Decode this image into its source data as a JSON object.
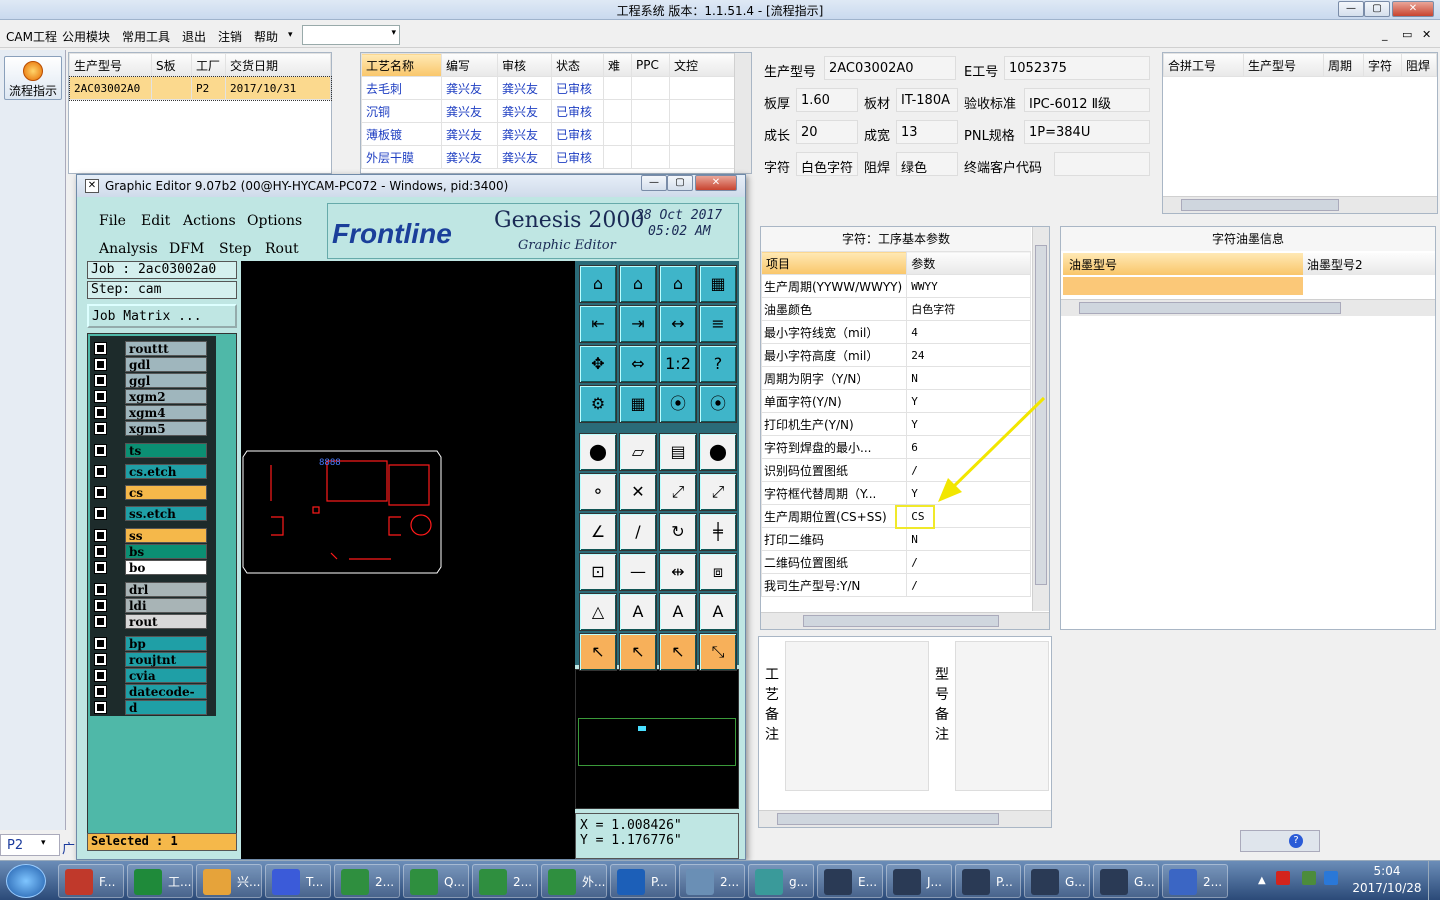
{
  "app": {
    "title": "工程系统  版本：1.1.51.4 - [流程指示]",
    "window_controls": [
      "—",
      "▢",
      "✕"
    ]
  },
  "menubar": {
    "items": [
      "CAM工程",
      "公用模块",
      "常用工具",
      "退出",
      "注销",
      "帮助"
    ],
    "help_arrow": "▾",
    "combo_value": "",
    "mdi_controls": [
      "_",
      "▭",
      "✕"
    ]
  },
  "sidebar": {
    "flow_button": "流程指示",
    "bottom_combo": "P2",
    "bottom_text": "广"
  },
  "order_table": {
    "headers": [
      "生产型号",
      "S板",
      "工厂",
      "交货日期"
    ],
    "rows": [
      [
        "2AC03002A0",
        "",
        "P2",
        "2017/10/31"
      ]
    ]
  },
  "process_table": {
    "headers": [
      "工艺名称",
      "编写",
      "审核",
      "状态",
      "难",
      "PPC",
      "文控"
    ],
    "rows": [
      [
        "去毛刺",
        "龚兴友",
        "龚兴友",
        "已审核",
        "",
        "",
        ""
      ],
      [
        "沉铜",
        "龚兴友",
        "龚兴友",
        "已审核",
        "",
        "",
        ""
      ],
      [
        "薄板镀",
        "龚兴友",
        "龚兴友",
        "已审核",
        "",
        "",
        ""
      ],
      [
        "外层干膜",
        "龚兴友",
        "龚兴友",
        "已审核",
        "",
        "",
        ""
      ]
    ]
  },
  "info_form": {
    "fields": [
      {
        "label": "生产型号",
        "value": "2AC03002A0"
      },
      {
        "label": "E工号",
        "value": "1052375"
      },
      {
        "label": "板厚",
        "value": "1.60"
      },
      {
        "label": "板材",
        "value": "IT-180A"
      },
      {
        "label": "验收标准",
        "value": "IPC-6012 Ⅱ级"
      },
      {
        "label": "成长",
        "value": "20"
      },
      {
        "label": "成宽",
        "value": "13"
      },
      {
        "label": "PNL规格",
        "value": "1P=384U"
      },
      {
        "label": "字符",
        "value": "白色字符"
      },
      {
        "label": "阻焊",
        "value": "绿色"
      },
      {
        "label": "终端客户代码",
        "value": ""
      }
    ]
  },
  "combined_table": {
    "headers": [
      "合拼工号",
      "生产型号",
      "周期",
      "字符",
      "阻焊"
    ]
  },
  "params_panel": {
    "title": "字符：工序基本参数",
    "headers": [
      "项目",
      "参数"
    ],
    "rows": [
      [
        "生产周期(YYWW/WWYY)",
        "WWYY"
      ],
      [
        "油墨颜色",
        "白色字符"
      ],
      [
        "最小字符线宽（mil）",
        "4"
      ],
      [
        "最小字符高度（mil）",
        "24"
      ],
      [
        "周期为阴字（Y/N）",
        "N"
      ],
      [
        "单面字符(Y/N)",
        "Y"
      ],
      [
        "打印机生产(Y/N)",
        "Y"
      ],
      [
        "字符到焊盘的最小...",
        "6"
      ],
      [
        "识别码位置图纸",
        "/"
      ],
      [
        "字符框代替周期（Y...",
        "Y"
      ],
      [
        "生产周期位置(CS+SS)",
        "CS"
      ],
      [
        "打印二维码",
        "N"
      ],
      [
        "二维码位置图纸",
        "/"
      ],
      [
        "我司生产型号:Y/N",
        "/"
      ]
    ],
    "highlight_value": "CS"
  },
  "ink_panel": {
    "title": "字符油墨信息",
    "headers": [
      "油墨型号",
      "油墨型号2"
    ]
  },
  "remarks": {
    "process_label": "工艺备注",
    "model_label": "型号备注"
  },
  "graphic_editor": {
    "title": "Graphic Editor 9.07b2 (00@HY-HYCAM-PC072 - Windows, pid:3400)",
    "menu_row1": [
      "File",
      "Edit",
      "Actions",
      "Options"
    ],
    "menu_row2": [
      "Analysis",
      "DFM",
      "Step",
      "Rout"
    ],
    "brand": "Frontline",
    "product": "Genesis 2000",
    "subtitle": "Graphic Editor",
    "date": "28 Oct 2017",
    "time": "05:02 AM",
    "job": "Job  : 2ac03002a0",
    "step": "Step: cam",
    "job_matrix": "Job Matrix ...",
    "selected": "Selected : 1",
    "x_coord": "X = 1.008426\"",
    "y_coord": "Y = 1.176776\"",
    "layers": [
      {
        "name": "routtt",
        "color": "#9fb6bd"
      },
      {
        "name": "gdl",
        "color": "#9fb6bd"
      },
      {
        "name": "ggl",
        "color": "#9fb6bd"
      },
      {
        "name": "xgm2",
        "color": "#9fb6bd"
      },
      {
        "name": "xgm4",
        "color": "#9fb6bd"
      },
      {
        "name": "xgm5",
        "color": "#9fb6bd"
      },
      {
        "name": "ts",
        "color": "#0b8f73"
      },
      {
        "name": "cs.etch",
        "color": "#1f9fa6"
      },
      {
        "name": "cs",
        "color": "#f5b84a"
      },
      {
        "name": "ss.etch",
        "color": "#1f9fa6"
      },
      {
        "name": "ss",
        "color": "#f5b84a"
      },
      {
        "name": "bs",
        "color": "#0b8f73"
      },
      {
        "name": "bo",
        "color": "#ffffff"
      },
      {
        "name": "drl",
        "color": "#a8b4b6"
      },
      {
        "name": "ldi",
        "color": "#a8b4b6"
      },
      {
        "name": "rout",
        "color": "#d8d8d8"
      },
      {
        "name": "bp",
        "color": "#1f9fa6"
      },
      {
        "name": "roujtnt",
        "color": "#1f9fa6"
      },
      {
        "name": "cvia",
        "color": "#1f9fa6"
      },
      {
        "name": "datecode-pbe",
        "color": "#1f9fa6"
      },
      {
        "name": "d",
        "color": "#1f9fa6"
      }
    ],
    "tool_glyphs": [
      "⌂",
      "⌂",
      "⌂",
      "▦",
      "⇤",
      "⇥",
      "↔",
      "≡",
      "✥",
      "⇔",
      "1:2",
      "?",
      "⚙",
      "▦",
      "⦿",
      "⦿",
      "⬤",
      "▱",
      "▤",
      "⬤",
      "⚬",
      "✕",
      "⤢",
      "⤢",
      "∠",
      "/",
      "↻",
      "╪",
      "⊡",
      "—",
      "⇹",
      "⧈",
      "△",
      "A",
      "A",
      "A",
      "↖",
      "↖",
      "↖",
      "⤡"
    ],
    "pcb_text": "8888"
  },
  "taskbar": {
    "items": [
      "F...",
      "工...",
      "兴...",
      "T...",
      "2...",
      "Q...",
      "2...",
      "外...",
      "P...",
      "2...",
      "g...",
      "E...",
      "J...",
      "P...",
      "G...",
      "G...",
      "2..."
    ],
    "time": "5:04",
    "date": "2017/10/28"
  },
  "colors": {
    "accent_yellow": "#f2e600",
    "header_orange": "#f9c66a",
    "ge_teal": "#bfe6e3",
    "pcb_red": "#ff1a1a"
  }
}
